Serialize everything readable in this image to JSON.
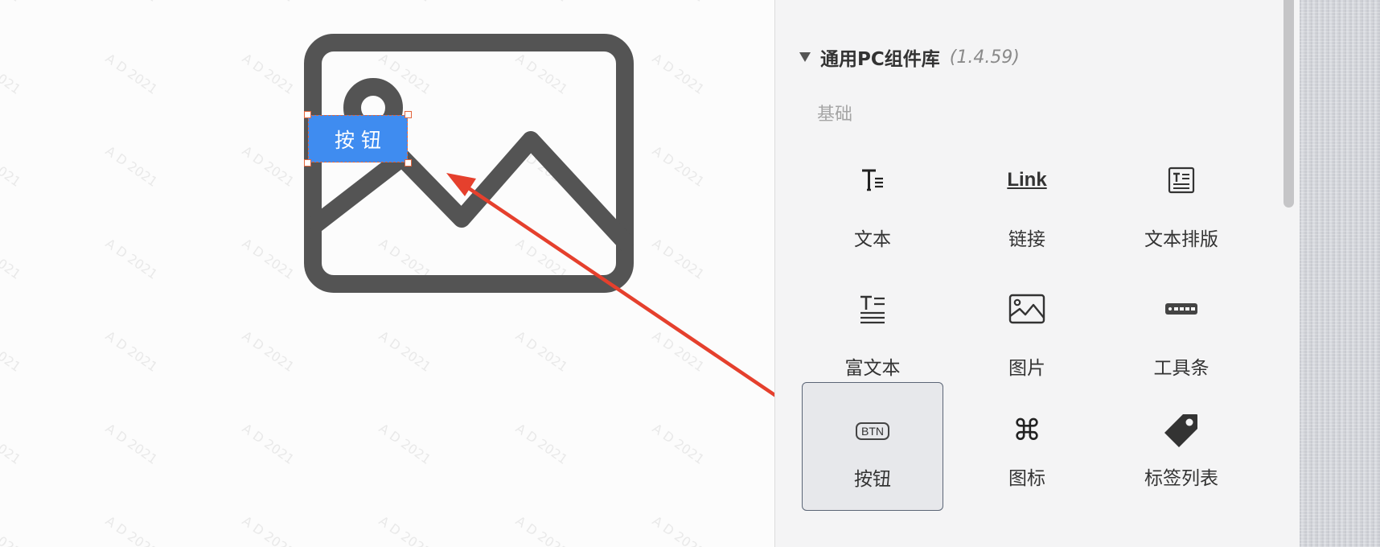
{
  "canvas": {
    "placed_button_label": "按钮",
    "watermark_text": "A D 2021"
  },
  "panel": {
    "library": {
      "title": "通用PC组件库",
      "version": "(1.4.59)"
    },
    "section_label": "基础",
    "components": [
      {
        "label": "文本",
        "icon": "text-icon"
      },
      {
        "label": "链接",
        "icon": "link-icon",
        "icon_text": "Link"
      },
      {
        "label": "文本排版",
        "icon": "text-layout-icon"
      },
      {
        "label": "富文本",
        "icon": "rich-text-icon"
      },
      {
        "label": "图片",
        "icon": "image-icon"
      },
      {
        "label": "工具条",
        "icon": "toolbar-icon"
      },
      {
        "label": "按钮",
        "icon": "button-icon",
        "icon_text": "BTN",
        "selected": true
      },
      {
        "label": "图标",
        "icon": "command-icon"
      },
      {
        "label": "标签列表",
        "icon": "tag-icon"
      }
    ]
  },
  "colors": {
    "accent_blue": "#3f8cf0",
    "selection_orange": "#e2653c",
    "arrow_red": "#e5402d",
    "placeholder_gray": "#545454"
  }
}
